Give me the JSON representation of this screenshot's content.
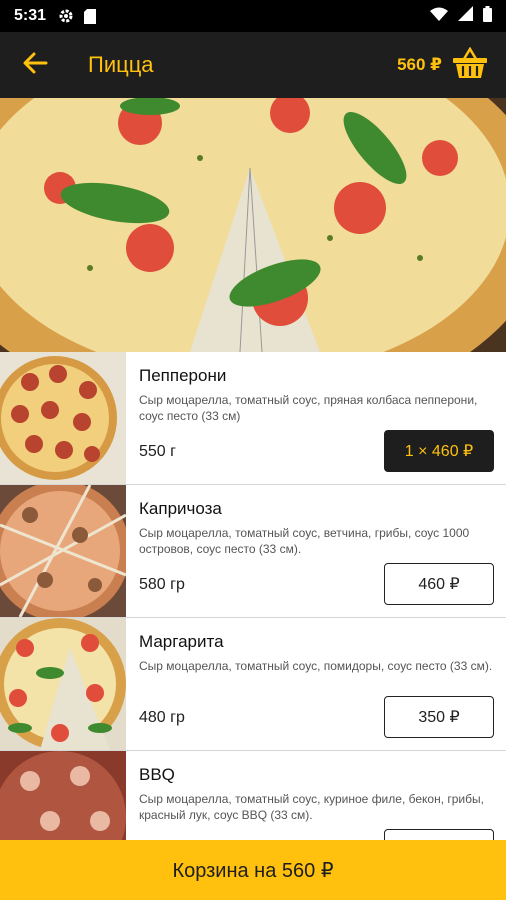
{
  "status_bar": {
    "time": "5:31",
    "icons": [
      "gear-icon",
      "sd-card-icon",
      "wifi-icon",
      "signal-icon",
      "battery-icon"
    ]
  },
  "app_bar": {
    "back_icon": "arrow-left-icon",
    "title": "Пицца",
    "cart_total": "560 ₽",
    "basket_icon": "basket-icon"
  },
  "products": [
    {
      "name": "Пепперони",
      "description": "Сыр моцарелла, томатный соус, пряная колбаса пепперони, соус песто (33 см)",
      "weight": "550 г",
      "price_label": "1 × 460 ₽",
      "in_cart": true
    },
    {
      "name": "Капричоза",
      "description": "Сыр моцарелла, томатный соус, ветчина, грибы, соус 1000 островов, соус песто (33 см).",
      "weight": "580 гр",
      "price_label": "460 ₽",
      "in_cart": false
    },
    {
      "name": "Маргарита",
      "description": "Сыр моцарелла, томатный соус, помидоры, соус песто (33 см).",
      "weight": "480 гр",
      "price_label": "350 ₽",
      "in_cart": false
    },
    {
      "name": "BBQ",
      "description": "Сыр моцарелла, томатный соус, куриное филе, бекон, грибы, красный лук, соус BBQ (33 см).",
      "weight": "",
      "price_label": "",
      "in_cart": false
    }
  ],
  "cart_button": {
    "label": "Корзина на 560 ₽"
  },
  "colors": {
    "accent": "#ffc10e",
    "app_bar_bg": "#1e1e1e",
    "status_bar_bg": "#000000"
  }
}
